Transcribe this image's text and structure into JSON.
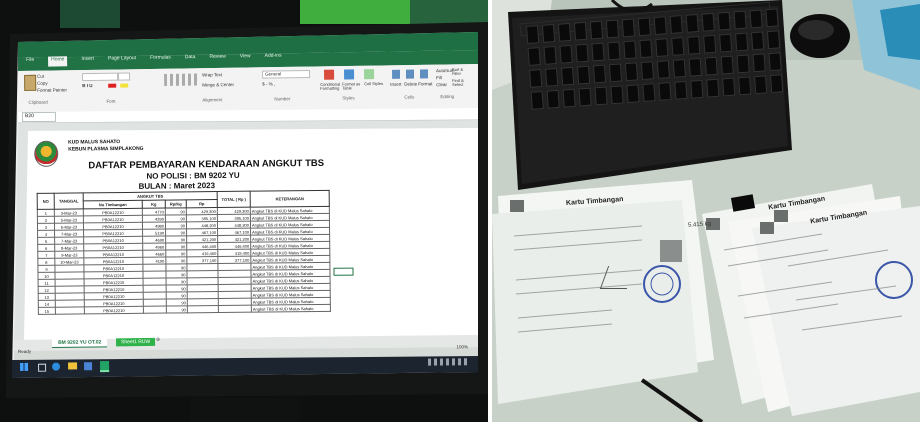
{
  "left_photo": {
    "ribbon_tabs": [
      "File",
      "Home",
      "Insert",
      "Page Layout",
      "Formulas",
      "Data",
      "Review",
      "View",
      "Add-ins"
    ],
    "ribbon_groups": [
      "Clipboard",
      "Font",
      "Alignment",
      "Number",
      "Styles",
      "Cells",
      "Editing"
    ],
    "clipboard": [
      "Cut",
      "Copy",
      "Format Painter"
    ],
    "alignment_buttons": [
      "Wrap Text",
      "Merge & Center"
    ],
    "number_format": "General",
    "styles_buttons": [
      "Conditional Formatting",
      "Format as Table",
      "Cell Styles"
    ],
    "cells_buttons": [
      "Insert",
      "Delete",
      "Format"
    ],
    "editing_buttons": [
      "AutoSum",
      "Fill",
      "Clear",
      "Sort & Filter",
      "Find & Select"
    ],
    "name_box": "B20",
    "company_line_1": "KUD MALUS SAHATO",
    "company_line_2": "KEBUN PLASMA SIMPLAKONG",
    "sheet_title": "DAFTAR PEMBAYARAN KENDARAAN ANGKUT TBS",
    "nopol_line": "NO POLISI : BM 9202 YU",
    "bulan_line": "BULAN : Maret 2023",
    "table_headers": [
      "NO",
      "TANGGAL",
      "ANGKUT TBS",
      "No Timbangan",
      "Kg",
      "Rp/Kg",
      "Rp",
      "TOTAL ( Rp )",
      "KETERANGAN"
    ],
    "rows": [
      {
        "no": "1",
        "tanggal": "3-Mar-23",
        "timb": "PB0A12210",
        "kg": "4770",
        "rpkg": "90",
        "rp": "429,300",
        "total": "429,300",
        "ket": "Angkut TBS di KUD Malus Sahato"
      },
      {
        "no": "2",
        "tanggal": "5-Mar-23",
        "timb": "PB0A12210",
        "kg": "4390",
        "rpkg": "90",
        "rp": "395,100",
        "total": "395,100",
        "ket": "Angkut TBS di KUD Malus Sahato"
      },
      {
        "no": "3",
        "tanggal": "6-Mar-23",
        "timb": "PB0A12210",
        "kg": "4980",
        "rpkg": "90",
        "rp": "448,200",
        "total": "448,200",
        "ket": "Angkut TBS di KUD Malus Sahato"
      },
      {
        "no": "4",
        "tanggal": "7-Mar-23",
        "timb": "PB0A12210",
        "kg": "5190",
        "rpkg": "90",
        "rp": "467,100",
        "total": "467,100",
        "ket": "Angkut TBS di KUD Malus Sahato"
      },
      {
        "no": "5",
        "tanggal": "7-Mar-23",
        "timb": "PB0A12210",
        "kg": "4690",
        "rpkg": "90",
        "rp": "421,200",
        "total": "421,200",
        "ket": "Angkut TBS di KUD Malus Sahato"
      },
      {
        "no": "6",
        "tanggal": "8-Mar-23",
        "timb": "PB0A12210",
        "kg": "4960",
        "rpkg": "90",
        "rp": "446,400",
        "total": "446,400",
        "ket": "Angkut TBS di KUD Malus Sahato"
      },
      {
        "no": "7",
        "tanggal": "9-Mar-23",
        "timb": "PB0A12210",
        "kg": "4660",
        "rpkg": "90",
        "rp": "419,400",
        "total": "419,400",
        "ket": "Angkut TBS di KUD Malus Sahato"
      },
      {
        "no": "8",
        "tanggal": "10-Mar-23",
        "timb": "PB0A12210",
        "kg": "4190",
        "rpkg": "90",
        "rp": "377,100",
        "total": "377,100",
        "ket": "Angkut TBS di KUD Malus Sahato"
      },
      {
        "no": "9",
        "tanggal": "",
        "timb": "PB0A12210",
        "kg": "",
        "rpkg": "90",
        "rp": "",
        "total": "",
        "ket": "Angkut TBS di KUD Malus Sahato"
      },
      {
        "no": "10",
        "tanggal": "",
        "timb": "PB0A12210",
        "kg": "",
        "rpkg": "90",
        "rp": "",
        "total": "",
        "ket": "Angkut TBS di KUD Malus Sahato"
      },
      {
        "no": "11",
        "tanggal": "",
        "timb": "PB0A12210",
        "kg": "",
        "rpkg": "90",
        "rp": "",
        "total": "",
        "ket": "Angkut TBS di KUD Malus Sahato"
      },
      {
        "no": "12",
        "tanggal": "",
        "timb": "PB0A12210",
        "kg": "",
        "rpkg": "90",
        "rp": "",
        "total": "",
        "ket": "Angkut TBS di KUD Malus Sahato"
      },
      {
        "no": "13",
        "tanggal": "",
        "timb": "PB0A12210",
        "kg": "",
        "rpkg": "90",
        "rp": "",
        "total": "",
        "ket": "Angkut TBS di KUD Malus Sahato"
      },
      {
        "no": "14",
        "tanggal": "",
        "timb": "PB0A12210",
        "kg": "",
        "rpkg": "90",
        "rp": "",
        "total": "",
        "ket": "Angkut TBS di KUD Malus Sahato"
      },
      {
        "no": "15",
        "tanggal": "",
        "timb": "PB0A12210",
        "kg": "",
        "rpkg": "90",
        "rp": "",
        "total": "",
        "ket": "Angkut TBS di KUD Malus Sahato"
      }
    ],
    "sheet_tabs": [
      "BM 9202 YU OT.02",
      "Sheet1 RUW"
    ],
    "status_left": "Ready",
    "status_zoom": "100%"
  },
  "right_photo": {
    "ticket_title_1": "Kartu Timbangan",
    "ticket_title_2": "Kartu Timbangan",
    "ticket_title_3": "Kartu Timbangan",
    "ticket_amount": "5.415 kg"
  },
  "colors": {
    "excel_green": "#217346",
    "tab_green": "#2fb24a",
    "desk": "#c9d3c9"
  }
}
